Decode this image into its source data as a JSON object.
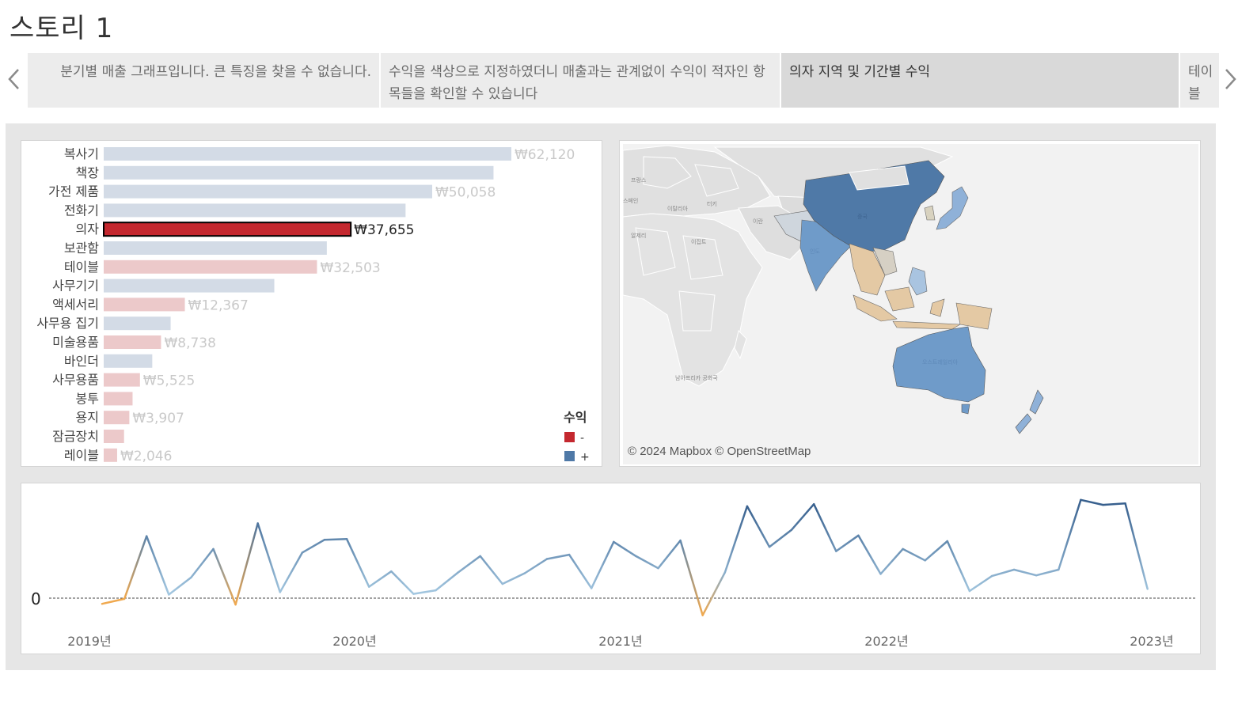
{
  "story": {
    "title": "스토리 1",
    "points": [
      "분기별 매출 그래프입니다. 큰 특징을 찾을 수 없습니다.",
      "수익을 색상으로 지정하였더니 매출과는 관계없이 수익이 적자인 항목들을 확인할 수 있습니다",
      "의자 지역 및 기간별 수익",
      "테이블 가장"
    ],
    "active_index": 2
  },
  "bar_chart": {
    "categories": [
      "복사기",
      "책장",
      "가전 제품",
      "전화기",
      "의자",
      "보관함",
      "테이블",
      "사무기기",
      "액세서리",
      "사무용 집기",
      "미술용품",
      "바인더",
      "사무용품",
      "봉투",
      "용지",
      "잠금장치",
      "레이블"
    ],
    "values": [
      62120,
      59400,
      50058,
      46000,
      37655,
      34000,
      32503,
      26000,
      12367,
      10200,
      8738,
      7400,
      5525,
      4400,
      3907,
      3100,
      2046
    ],
    "labels": [
      "₩62,120",
      "",
      "₩50,058",
      "",
      "₩37,655",
      "",
      "₩32,503",
      "",
      "₩12,367",
      "",
      "₩8,738",
      "",
      "₩5,525",
      "",
      "₩3,907",
      "",
      "₩2,046"
    ],
    "profit_sign": [
      "+",
      "+",
      "+",
      "+",
      "-",
      "+",
      "-",
      "+",
      "-",
      "+",
      "-",
      "+",
      "-",
      "-",
      "-",
      "-",
      "-"
    ],
    "highlighted": "의자",
    "legend": {
      "title": "수익",
      "neg": "-",
      "pos": "+"
    },
    "colors": {
      "neg": "#c4282f",
      "pos": "#4f79a7",
      "neg_faded": "#ecc9ca",
      "pos_faded": "#d3dbe6"
    }
  },
  "map": {
    "credit": "© 2024 Mapbox © OpenStreetMap",
    "labels": [
      "프랑스",
      "스페인",
      "이탈리아",
      "터키",
      "이란",
      "이집트",
      "알제리",
      "중국",
      "인도",
      "남아프리카 공화국",
      "오스트레일리아"
    ]
  },
  "chart_data": {
    "type": "line",
    "x_ticks": [
      "2019년",
      "2020년",
      "2021년",
      "2022년",
      "2023년"
    ],
    "x_start": "2019-01",
    "x_end": "2023-12",
    "zero_label": "0",
    "ylim": [
      -1200,
      6000
    ],
    "series": [
      {
        "values": [
          -400,
          -50,
          4350,
          250,
          1450,
          3450,
          -450,
          5250,
          420,
          3200,
          4100,
          4150,
          800,
          1880,
          300,
          550,
          1800,
          2950,
          1000,
          1750,
          2750,
          3050,
          700,
          3950,
          2950,
          2100,
          4050,
          -1200,
          1800,
          6450,
          3600,
          4800,
          6600,
          3300,
          4400,
          1700,
          3450,
          2650,
          4000,
          500,
          1550,
          2000,
          1600,
          2000,
          6900,
          6550,
          6650,
          650
        ]
      }
    ]
  }
}
